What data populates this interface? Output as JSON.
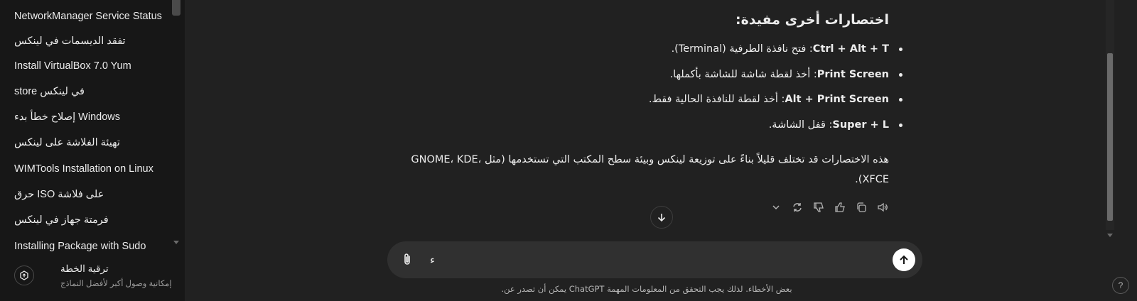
{
  "sidebar": {
    "items": [
      {
        "label": "NetworkManager Service Status"
      },
      {
        "label": "تفقد الديسمات في لينكس"
      },
      {
        "label": "Install VirtualBox 7.0 Yum"
      },
      {
        "label": "store في لينكس"
      },
      {
        "label": "إصلاح خطأ بدء Windows"
      },
      {
        "label": "تهيئة الفلاشة على لينكس"
      },
      {
        "label": "WIMTools Installation on Linux"
      },
      {
        "label": "حرق ISO على فلاشة"
      },
      {
        "label": "فرمتة جهاز في لينكس"
      },
      {
        "label": "Installing Package with Sudo"
      }
    ],
    "upgrade": {
      "title": "ترقية الخطة",
      "subtitle": "إمكانية وصول أكبر لأفضل النماذج"
    }
  },
  "message": {
    "heading": "اختصارات أخرى مفيدة:",
    "bullets": [
      {
        "key": "Ctrl + Alt + T",
        "text": ": فتح نافذة الطرفية (Terminal)."
      },
      {
        "key": "Print Screen",
        "text": ": أخذ لقطة شاشة للشاشة بأكملها."
      },
      {
        "key": "Alt + Print Screen",
        "text": ": أخذ لقطة للنافذة الحالية فقط."
      },
      {
        "key": "Super + L",
        "text": ": قفل الشاشة."
      }
    ],
    "paragraph": "هذه الاختصارات قد تختلف قليلاً بناءً على توزيعة لينكس وبيئة سطح المكتب التي تستخدمها (مثل GNOME، KDE، XFCE)."
  },
  "actions": [
    "read-aloud-icon",
    "copy-icon",
    "thumbs-up-icon",
    "thumbs-down-icon",
    "regenerate-icon",
    "model-switch-chevron-icon"
  ],
  "composer": {
    "value": "ء",
    "placeholder": ""
  },
  "footer": {
    "disclaimer": "بعض الأخطاء. لذلك يجب التحقق من المعلومات المهمة ChatGPT يمكن أن تصدر عن.",
    "help": "?"
  },
  "colors": {
    "background": "#212121",
    "sidebar": "#171717",
    "composer": "#303030",
    "text": "#ececec",
    "muted": "#b4b4b4"
  }
}
